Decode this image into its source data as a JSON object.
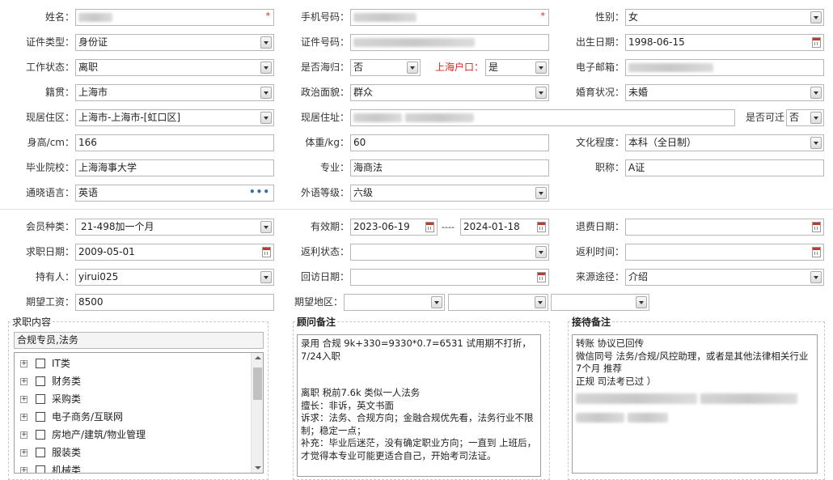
{
  "labels": {
    "name": "姓名：",
    "phone": "手机号码：",
    "gender": "性别：",
    "id_type": "证件类型：",
    "id_no": "证件号码：",
    "birth": "出生日期：",
    "work_status": "工作状态：",
    "overseas": "是否海归：",
    "shanghai_hukou": "上海户口：",
    "email": "电子邮箱：",
    "native": "籍贯：",
    "political": "政治面貌：",
    "marital": "婚育状况：",
    "area": "现居住区：",
    "address": "现居住址：",
    "relocate": "是否可迁",
    "height": "身高/cm：",
    "weight": "体重/kg：",
    "education": "文化程度：",
    "school": "毕业院校：",
    "major": "专业：",
    "title": "职称：",
    "language": "通晓语言：",
    "foreign_level": "外语等级：",
    "member_type": "会员种类：",
    "valid": "有效期：",
    "refund_date": "退费日期：",
    "job_date": "求职日期：",
    "rebate_status": "返利状态：",
    "rebate_time": "返利时间：",
    "holder": "持有人：",
    "visit_date": "回访日期：",
    "source": "来源途径：",
    "salary": "期望工资：",
    "exp_area": "期望地区："
  },
  "values": {
    "gender": "女",
    "id_type": "身份证",
    "birth": "1998-06-15",
    "work_status": "离职",
    "overseas": "否",
    "shanghai_hukou": "是",
    "native": "上海市",
    "political": "群众",
    "marital": "未婚",
    "area": "上海市-上海市-[虹口区]",
    "relocate": "否",
    "height": "166",
    "weight": "60",
    "education": "本科（全日制）",
    "school": "上海海事大学",
    "major": "海商法",
    "title": "A证",
    "language": "英语",
    "foreign_level": "六级",
    "member_type": "21-498加一个月",
    "valid_from": "2023-06-19",
    "valid_sep": "----",
    "valid_to": "2024-01-18",
    "job_date": "2009-05-01",
    "holder": "yirui025",
    "source": "介绍",
    "salary": "8500"
  },
  "job_section": {
    "title": "求职内容",
    "selected": "合规专员,法务",
    "categories": [
      "IT类",
      "财务类",
      "采购类",
      "电子商务/互联网",
      "房地产/建筑/物业管理",
      "服装类",
      "机械类"
    ]
  },
  "advisor_notes": {
    "title": "顾问备注",
    "lines": [
      "录用  合规   9k+330=9330*0.7=6531  试用期不打折，7/24入职",
      "",
      "",
      "离职  税前7.6k   类似一人法务",
      "擅长：非诉，英文书面",
      "诉求：法务、合规方向；金融合规优先看，法务行业不限制；稳定一点；",
      "补充：毕业后迷茫，没有确定职业方向；一直到    上班后，才觉得本专业可能更适合自己，开始考司法证。"
    ]
  },
  "reception_notes": {
    "title": "接待备注",
    "lines": [
      "转账  协议已回传",
      "微信同号 法务/合规/风控助理，或者是其他法律相关行业   7个月    推荐",
      "正规  司法考已过  ）"
    ]
  },
  "icons": {
    "dropdown": "chevron-down-icon",
    "calendar": "calendar-icon",
    "more": "ellipsis-icon",
    "expand": "plus-icon"
  },
  "colors": {
    "required": "#d9241c",
    "border": "#b7b7b7",
    "highlight": "#d9241c"
  }
}
